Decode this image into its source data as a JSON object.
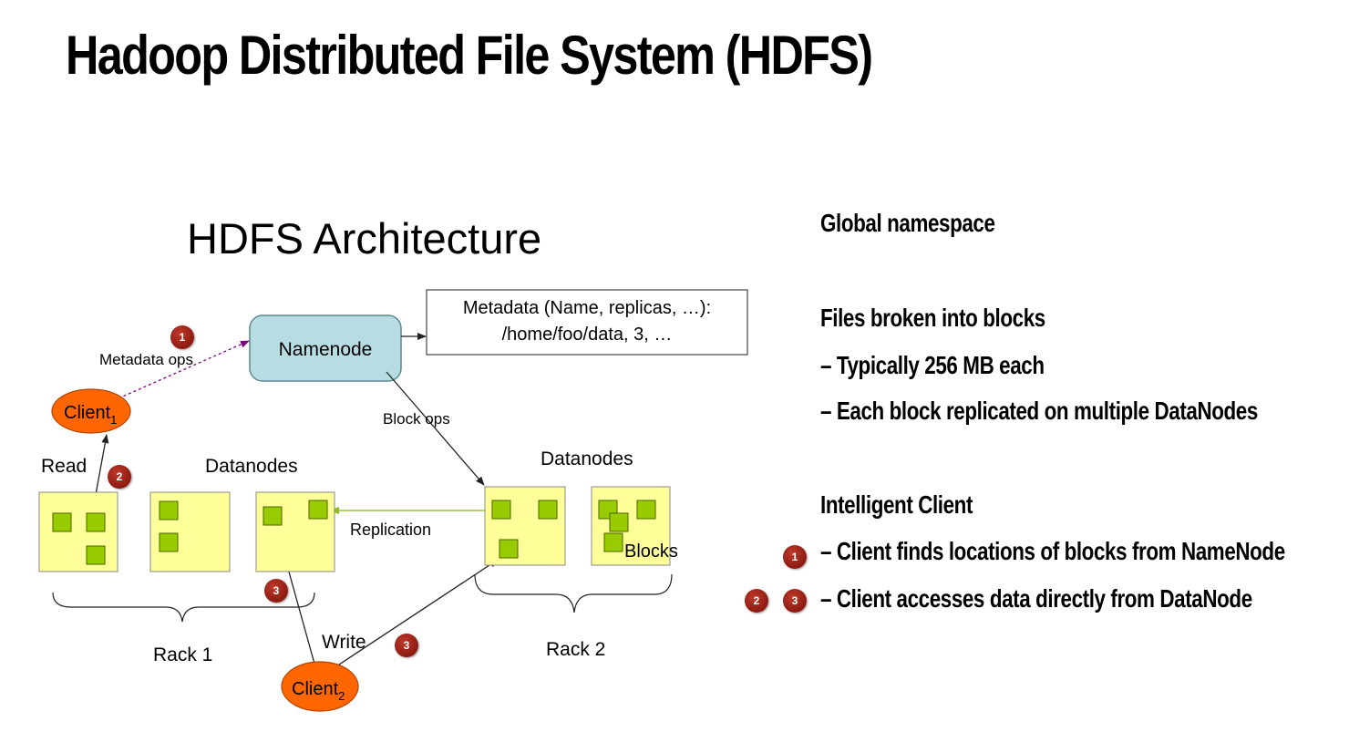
{
  "slide": {
    "title": "Hadoop Distributed File System (HDFS)"
  },
  "diagram": {
    "title": "HDFS Architecture",
    "metadata_box": {
      "line1": "Metadata (Name, replicas, …):",
      "line2": "/home/foo/data, 3, …"
    },
    "namenode": "Namenode",
    "client1": {
      "label": "Client",
      "sub": "1"
    },
    "client2": {
      "label": "Client",
      "sub": "2"
    },
    "labels": {
      "metadata_ops": "Metadata ops",
      "block_ops": "Block ops",
      "read": "Read",
      "datanodes_left": "Datanodes",
      "datanodes_right": "Datanodes",
      "replication": "Replication",
      "blocks": "Blocks",
      "write": "Write",
      "rack1": "Rack 1",
      "rack2": "Rack 2"
    },
    "badges": {
      "b1": "1",
      "b2": "2",
      "b3a": "3",
      "b3b": "3"
    },
    "colors": {
      "namenode_fill": "#b7dde3",
      "client_fill": "#ff6600",
      "datanode_fill": "#ffff99",
      "block_fill": "#99cc00",
      "badge_fill": "#a52a1a",
      "replication_arrow": "#99cc33",
      "metadata_arrow": "#800080"
    }
  },
  "bullets": {
    "global_namespace": "Global namespace",
    "files_blocks": "Files broken into blocks",
    "typically": "– Typically  256 MB each",
    "replicated": "– Each block replicated on multiple DataNodes",
    "intelligent": "Intelligent Client",
    "finds": "– Client finds locations of blocks from NameNode",
    "accesses": "– Client accesses data directly from DataNode",
    "badge_1": "1",
    "badge_2": "2",
    "badge_3": "3"
  }
}
